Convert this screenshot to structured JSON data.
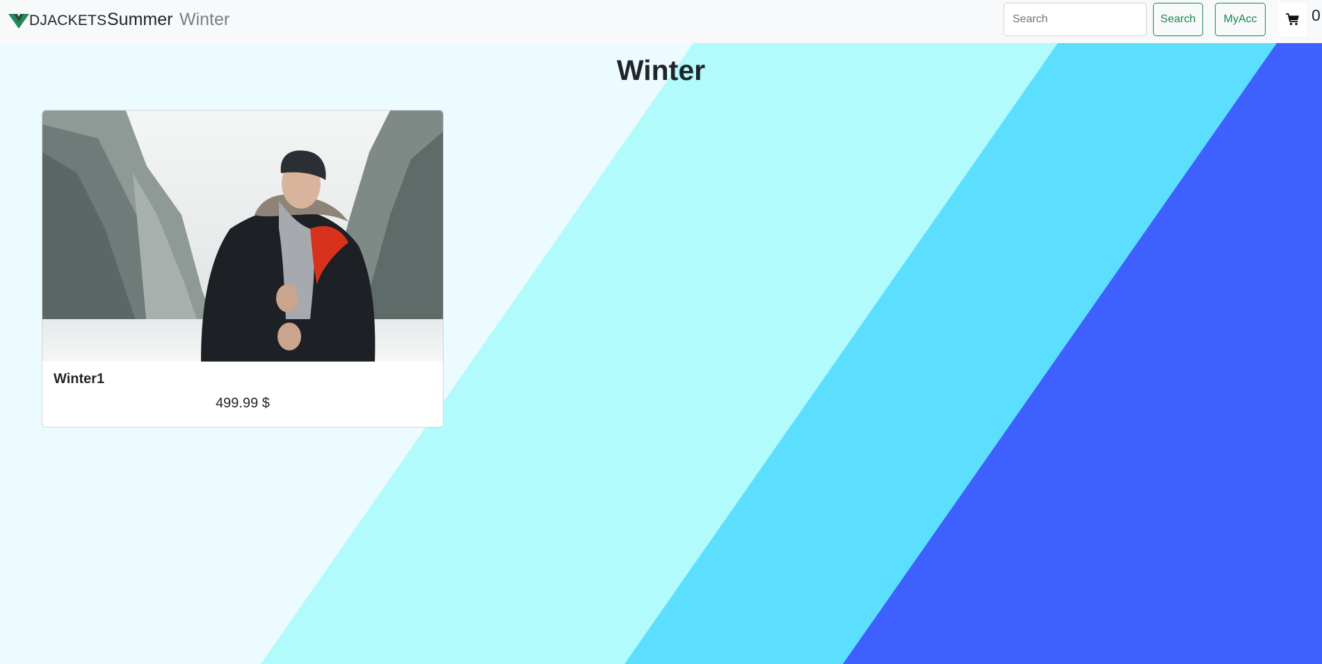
{
  "navbar": {
    "brand": "DJACKETS",
    "links": [
      {
        "label": "Summer"
      },
      {
        "label": "Winter"
      }
    ],
    "search": {
      "placeholder": "Search",
      "value": "",
      "button_label": "Search"
    },
    "account_button_label": "MyAcc",
    "cart": {
      "icon": "cart-icon",
      "count": "0"
    }
  },
  "page": {
    "title": "Winter"
  },
  "products": [
    {
      "name": "Winter1",
      "price": "499.99 $",
      "image": "man-in-winter-jacket-photo"
    }
  ],
  "colors": {
    "navbar_bg": "#f8f9fa",
    "bg_stripe_1": "#ebfbff",
    "bg_stripe_2": "#b1fbfd",
    "bg_stripe_3": "#5cdeff",
    "bg_stripe_4": "#3d60ff",
    "accent_green": "#198754",
    "brand_logo": "#1e8a5a"
  }
}
